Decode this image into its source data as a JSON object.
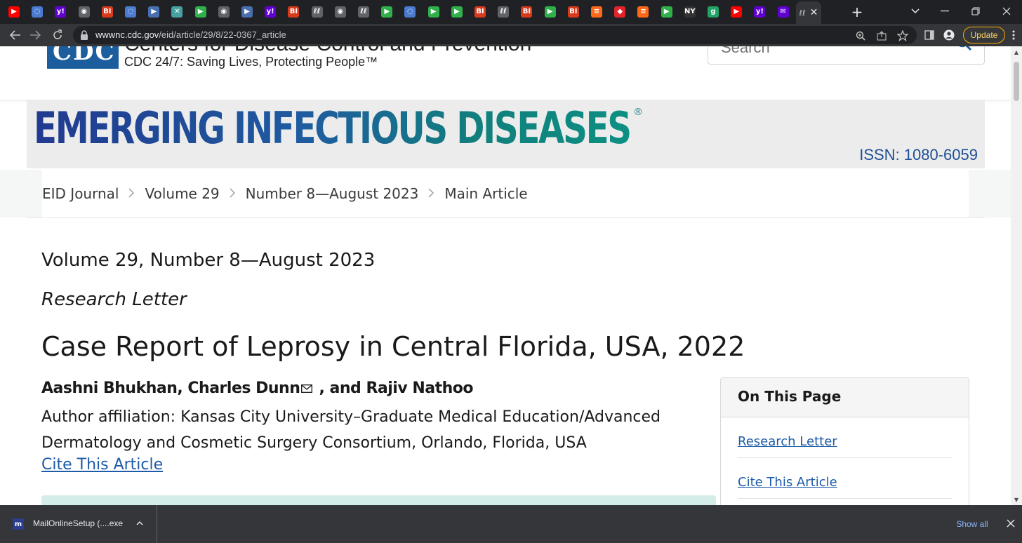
{
  "browser": {
    "tab_favicons": [
      {
        "icon": "youtube-icon",
        "glyph": "▶",
        "color": "#ff0000"
      },
      {
        "icon": "shield-icon",
        "glyph": "◌",
        "color": "#4a7bd0"
      },
      {
        "icon": "yahoo-icon",
        "glyph": "y!",
        "color": "#6001d2"
      },
      {
        "icon": "globe-icon",
        "glyph": "◉",
        "color": "#5f6368"
      },
      {
        "icon": "bi-icon",
        "glyph": "BI",
        "color": "#d93a1c"
      },
      {
        "icon": "shield-icon",
        "glyph": "◌",
        "color": "#4a7bd0"
      },
      {
        "icon": "flag-icon",
        "glyph": "▶",
        "color": "#4a6fb0"
      },
      {
        "icon": "puzzle-icon",
        "glyph": "✕",
        "color": "#46a1a0"
      },
      {
        "icon": "play-icon",
        "glyph": "▶",
        "color": "#30b04b"
      },
      {
        "icon": "globe-icon",
        "glyph": "◉",
        "color": "#5f6368"
      },
      {
        "icon": "flag-icon",
        "glyph": "▶",
        "color": "#4a6fb0"
      },
      {
        "icon": "yahoo-icon",
        "glyph": "y!",
        "color": "#6001d2"
      },
      {
        "icon": "bi-icon",
        "glyph": "BI",
        "color": "#d93a1c"
      },
      {
        "icon": "article-icon",
        "glyph": "ℓℓ",
        "color": "#5f6368"
      },
      {
        "icon": "globe-icon",
        "glyph": "◉",
        "color": "#5f6368"
      },
      {
        "icon": "article-icon",
        "glyph": "ℓℓ",
        "color": "#5f6368"
      },
      {
        "icon": "play-icon",
        "glyph": "▶",
        "color": "#30b04b"
      },
      {
        "icon": "shield-icon",
        "glyph": "◌",
        "color": "#4a7bd0"
      },
      {
        "icon": "play-icon",
        "glyph": "▶",
        "color": "#30b04b"
      },
      {
        "icon": "play-icon",
        "glyph": "▶",
        "color": "#30b04b"
      },
      {
        "icon": "bi-icon",
        "glyph": "BI",
        "color": "#d93a1c"
      },
      {
        "icon": "article-icon",
        "glyph": "ℓℓ",
        "color": "#5f6368"
      },
      {
        "icon": "bi-icon",
        "glyph": "BI",
        "color": "#d93a1c"
      },
      {
        "icon": "play-icon",
        "glyph": "▶",
        "color": "#30b04b"
      },
      {
        "icon": "bi-icon",
        "glyph": "BI",
        "color": "#d93a1c"
      },
      {
        "icon": "substack-icon",
        "glyph": "≡",
        "color": "#ff6719"
      },
      {
        "icon": "pin-icon",
        "glyph": "◆",
        "color": "#e0242a"
      },
      {
        "icon": "substack-icon",
        "glyph": "≡",
        "color": "#ff6719"
      },
      {
        "icon": "play-icon",
        "glyph": "▶",
        "color": "#30b04b"
      },
      {
        "icon": "news-icon",
        "glyph": "NY",
        "color": "#333333"
      },
      {
        "icon": "g-icon",
        "glyph": "g",
        "color": "#21a366"
      },
      {
        "icon": "youtube-icon",
        "glyph": "▶",
        "color": "#ff0000"
      },
      {
        "icon": "yahoo-icon",
        "glyph": "y!",
        "color": "#6001d2"
      },
      {
        "icon": "yahoo-mail-icon",
        "glyph": "✉",
        "color": "#6001d2"
      }
    ],
    "active_tab_close": "✕",
    "active_tab_glyph": "ℓℓ",
    "new_tab": "+",
    "url_host": "wwwnc.cdc.gov",
    "url_path": "/eid/article/29/8/22-0367_article",
    "update_label": "Update"
  },
  "header": {
    "site_title": "Centers for Disease Control and Prevention",
    "tagline": "CDC 24/7: Saving Lives, Protecting People™",
    "logo_text": "CDC",
    "search_placeholder": "Search"
  },
  "banner": {
    "journal_title": "EMERGING INFECTIOUS DISEASES",
    "registered": "®",
    "issn": "ISSN: 1080-6059"
  },
  "breadcrumb": [
    "EID Journal",
    "Volume 29",
    "Number 8—August 2023",
    "Main Article"
  ],
  "article": {
    "volume_line": "Volume 29, Number 8—August 2023",
    "type": "Research Letter",
    "title": "Case Report of Leprosy in Central Florida, USA, 2022",
    "authors_part1": "Aashni Bhukhan, Charles Dunn",
    "authors_part2": " , and Rajiv Nathoo",
    "affiliation": "Author affiliation: Kansas City University–Graduate Medical Education/Advanced Dermatology and Cosmetic Surgery Consortium, Orlando, Florida, USA",
    "cite_link": "Cite This Article"
  },
  "on_this_page": {
    "heading": "On This Page",
    "items": [
      "Research Letter",
      "Cite This Article"
    ]
  },
  "downloads": {
    "file_name": "MailOnlineSetup (....exe",
    "show_all": "Show all"
  },
  "colors": {
    "chrome_dark": "#202124",
    "chrome_toolbar": "#35363a",
    "link_blue": "#1d5ba8",
    "issn_blue": "#1f4f93",
    "update_amber": "#fdd663"
  }
}
